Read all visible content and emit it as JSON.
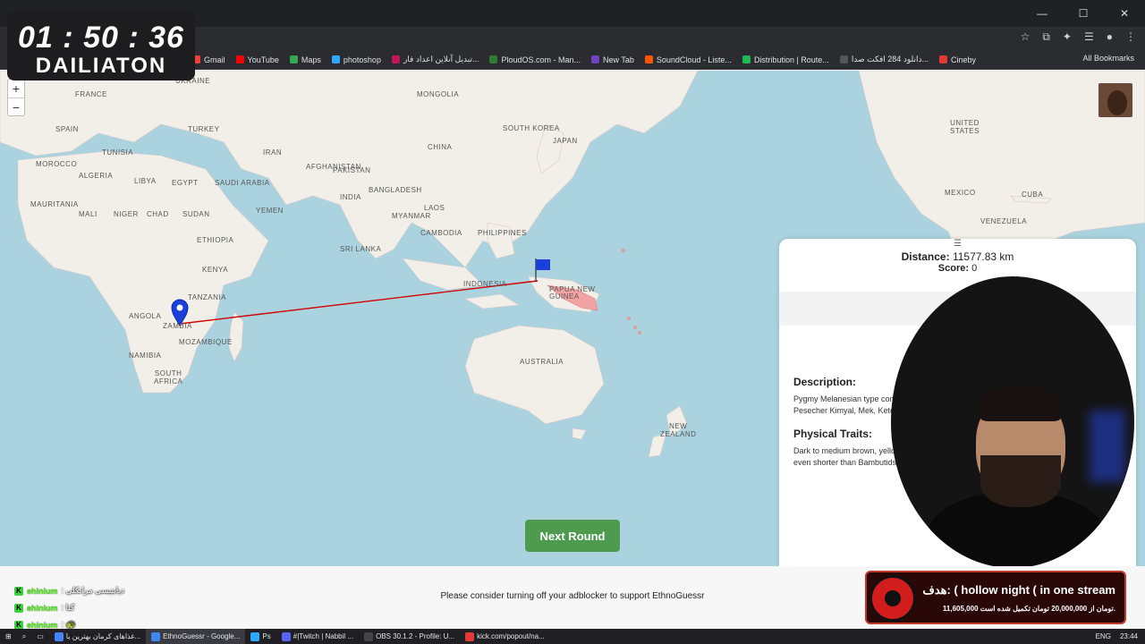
{
  "timer": {
    "time": "01 : 50 : 36",
    "label": "DAILIATON"
  },
  "bookmarks": [
    {
      "label": "Gmail",
      "color": "#ea4335"
    },
    {
      "label": "YouTube",
      "color": "#ff0000"
    },
    {
      "label": "Maps",
      "color": "#34a853"
    },
    {
      "label": "photoshop",
      "color": "#31a8ff"
    },
    {
      "label": "تبدیل آنلاین اعداد فار...",
      "color": "#c2185b"
    },
    {
      "label": "PloudOS.com - Man...",
      "color": "#2e7d32"
    },
    {
      "label": "New Tab",
      "color": "#6f42c1"
    },
    {
      "label": "SoundCloud - Liste...",
      "color": "#ff5500"
    },
    {
      "label": "Distribution | Route...",
      "color": "#1db954"
    },
    {
      "label": "دانلود 284 افکت صدا...",
      "color": "#555555"
    },
    {
      "label": "Cineby",
      "color": "#e53935"
    }
  ],
  "all_bookmarks": "All Bookmarks",
  "map": {
    "zoom_in": "+",
    "zoom_out": "−",
    "labels": {
      "ukraine": "UKRAINE",
      "france": "FRANCE",
      "spain": "SPAIN",
      "turkey": "TURKEY",
      "mongolia": "MONGOLIA",
      "morocco": "MOROCCO",
      "tunisia": "TUNISIA",
      "iran": "IRAN",
      "afghanistan": "AFGHANISTAN",
      "china": "CHINA",
      "south_korea": "SOUTH KOREA",
      "japan": "JAPAN",
      "algeria": "ALGERIA",
      "libya": "LIBYA",
      "egypt": "EGYPT",
      "saudi_arabia": "SAUDI ARABIA",
      "pakistan": "PAKISTAN",
      "india": "INDIA",
      "bangladesh": "BANGLADESH",
      "laos": "LAOS",
      "mauritania": "MAURITANIA",
      "mali": "MALI",
      "niger": "NIGER",
      "chad": "CHAD",
      "sudan": "SUDAN",
      "yemen": "YEMEN",
      "myanmar": "MYANMAR",
      "cambodia": "CAMBODIA",
      "philippines": "PHILIPPINES",
      "ethiopia": "ETHIOPIA",
      "sri_lanka": "SRI LANKA",
      "kenya": "KENYA",
      "indonesia": "INDONESIA",
      "papua_new_guinea": "PAPUA NEW\nGUINEA",
      "tanzania": "TANZANIA",
      "angola": "ANGOLA",
      "zambia": "ZAMBIA",
      "mozambique": "MOZAMBIQUE",
      "namibia": "NAMIBIA",
      "south_africa": "SOUTH\nAFRICA",
      "australia": "AUSTRALIA",
      "new_zealand": "NEW\nZEALAND",
      "united_states": "UNITED\nSTATES",
      "mexico": "MEXICO",
      "cuba": "CUBA",
      "venezuela": "VENEZUELA"
    }
  },
  "next_round": "Next Round",
  "result": {
    "menu": "☰",
    "distance_label": "Distance:",
    "distance_value": "11577.83 km",
    "score_label": "Score:",
    "score_value": "0",
    "description_heading": "Description:",
    "description_text": "Pygmy Melanesian type common history with it secondary adaption dri Tapiro. Also in Pesecher Kimyal, Mek, Ketengbar Archipelago.",
    "traits_heading": "Physical Traits:",
    "traits_text": "Dark to medium brown, yellow black, sometimes red or blonde hair. (Very) short, the Kimyal even shorter than Bambutids. Mesoskelic, mesomorph to ectomorph. Small-headed."
  },
  "adblock_text": "Please consider turning off your adblocker to support EthnoGuessr",
  "chat": [
    {
      "user": "ehinium",
      "msg": ": دیابتیسی مرانکلی"
    },
    {
      "user": "ehinium",
      "msg": ": کنا"
    },
    {
      "user": "ehinium",
      "msg": ": 🐢"
    }
  ],
  "goal": {
    "title": "هدف: ( hollow night ( in one stream",
    "sub": "11,605,000 تومان از 20,000,000 تومان تکمیل شده است."
  },
  "taskbar": {
    "items": [
      {
        "label": "غذاهای کرمان بهترین یا...",
        "color": "#4285f4",
        "active": false
      },
      {
        "label": "EthnoGuessr - Google...",
        "color": "#4285f4",
        "active": true
      },
      {
        "label": "Ps",
        "color": "#31a8ff",
        "active": false
      },
      {
        "label": "#|Twitch | Nabbil ...",
        "color": "#5865f2",
        "active": false
      },
      {
        "label": "OBS 30.1.2 - Profile: U...",
        "color": "#444444",
        "active": false
      },
      {
        "label": "kick.com/popout/na...",
        "color": "#e53935",
        "active": false
      }
    ],
    "lang": "ENG",
    "time": "23:44"
  }
}
